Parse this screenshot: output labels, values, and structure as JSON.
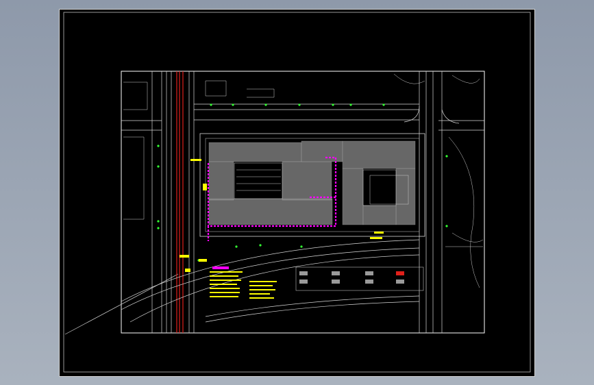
{
  "colors": {
    "background": "#9aa4b3",
    "sheet": "#000000",
    "frame": "#ffffff",
    "linework": "#d8d8d8",
    "road_red": "#e0201a",
    "pipe_magenta": "#ff00ff",
    "annotation_yellow": "#ffff00",
    "tree_green": "#33ff33"
  }
}
